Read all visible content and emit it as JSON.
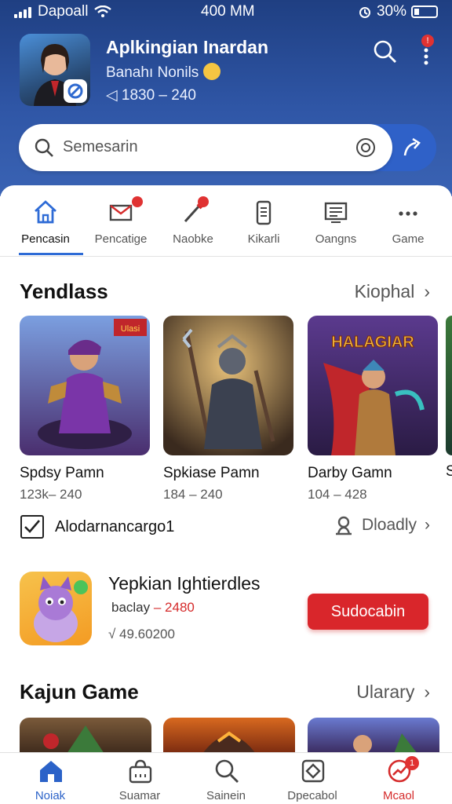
{
  "status": {
    "carrier": "Dapoall",
    "time": "400 MM",
    "battery": "30%"
  },
  "header": {
    "title": "Aplkingian Inardan",
    "subtitle": "Banahı Nonils",
    "range": "1830 – 240"
  },
  "search": {
    "placeholder": "Semesarin"
  },
  "tabs": [
    {
      "label": "Pencasin",
      "icon": "home-icon",
      "active": true
    },
    {
      "label": "Pencatige",
      "icon": "mail-icon",
      "badge": true
    },
    {
      "label": "Naobke",
      "icon": "pen-icon",
      "badge": true
    },
    {
      "label": "Kikarli",
      "icon": "device-icon"
    },
    {
      "label": "Oangns",
      "icon": "list-icon"
    },
    {
      "label": "Game",
      "icon": "more-icon"
    }
  ],
  "section1": {
    "title": "Yendlass",
    "more": "Kiophal"
  },
  "games": [
    {
      "name": "Spdsy Pamn",
      "range": "123k– 240",
      "tag": "Ulasi"
    },
    {
      "name": "Spkiase Pamn",
      "range": "184 – 240"
    },
    {
      "name": "Darby Gamn",
      "range": "104 – 428",
      "banner": "HALAGIAR"
    }
  ],
  "row": {
    "label": "Alodarnancargo1",
    "download": "Dloadly"
  },
  "featured": {
    "title": "Yepkian Ightierdles",
    "sub_prefix": "baclay",
    "sub_value": "– 2480",
    "version": "√ 49.60200",
    "button": "Sudocabin"
  },
  "section2": {
    "title": "Kajun Game",
    "more": "Ularary"
  },
  "bottom_nav": [
    {
      "label": "Noiak",
      "icon": "home-icon",
      "active": true
    },
    {
      "label": "Suamar",
      "icon": "bag-icon"
    },
    {
      "label": "Sainein",
      "icon": "search-icon"
    },
    {
      "label": "Dpecabol",
      "icon": "shield-icon"
    },
    {
      "label": "Mcaol",
      "icon": "chart-icon",
      "badge": "1"
    }
  ],
  "colors": {
    "accent": "#2e6bd6",
    "header": "#2f56a6",
    "danger": "#d9262b"
  }
}
